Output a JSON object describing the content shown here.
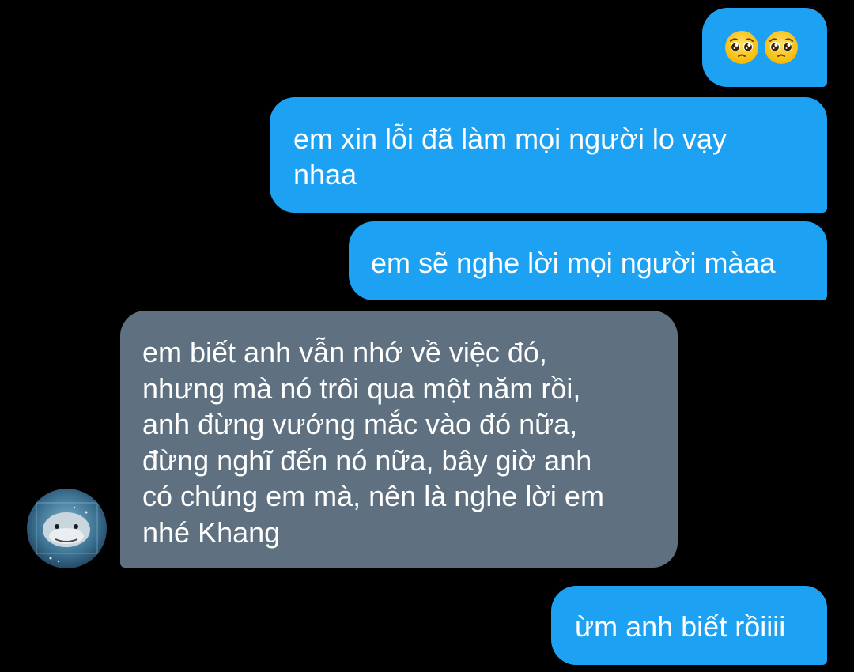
{
  "conversation": {
    "messages": [
      {
        "sender": "me",
        "emojis": [
          "pleading-face",
          "pleading-face"
        ]
      },
      {
        "sender": "me",
        "text": "em xin lỗi đã làm mọi người lo vạy\nnhaa"
      },
      {
        "sender": "me",
        "text": "em sẽ nghe lời mọi người màaa"
      },
      {
        "sender": "other",
        "text": "em biết anh vẫn nhớ về việc đó,\nnhưng mà nó trôi qua một năm rồi,\nanh đừng vướng mắc vào đó nữa,\nđừng nghĩ đến nó nữa, bây giờ anh\ncó chúng em mà, nên là nghe lời em\nnhé Khang"
      },
      {
        "sender": "me",
        "text": "ừm anh biết rồiiii"
      }
    ]
  },
  "colors": {
    "background": "#000000",
    "sent_bubble": "#1da1f2",
    "received_bubble": "#5f7180",
    "text": "#ffffff"
  }
}
